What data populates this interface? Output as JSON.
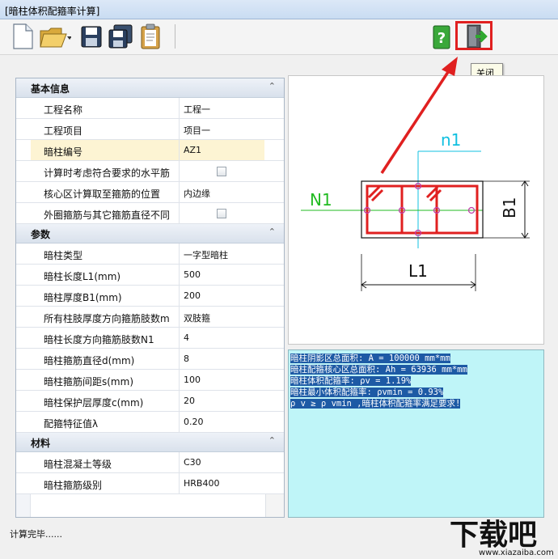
{
  "window": {
    "title": "[暗柱体积配箍率计算]"
  },
  "toolbar": {
    "tooltip": "关闭",
    "icons": [
      "new-file-icon",
      "open-folder-icon",
      "save-icon",
      "save-all-icon",
      "clipboard-icon",
      "help-icon",
      "exit-icon"
    ]
  },
  "props": {
    "basic": {
      "header": "基本信息",
      "rows": [
        {
          "label": "工程名称",
          "value": "工程一"
        },
        {
          "label": "工程项目",
          "value": "项目一"
        },
        {
          "label": "暗柱编号",
          "value": "AZ1"
        },
        {
          "label": "计算时考虑符合要求的水平筋",
          "value": ""
        },
        {
          "label": "核心区计算取至箍筋的位置",
          "value": "内边缘"
        },
        {
          "label": "外圈箍筋与其它箍筋直径不同",
          "value": ""
        }
      ]
    },
    "params": {
      "header": "参数",
      "rows": [
        {
          "label": "暗柱类型",
          "value": "一字型暗柱"
        },
        {
          "label": "暗柱长度L1(mm)",
          "value": "500"
        },
        {
          "label": "暗柱厚度B1(mm)",
          "value": "200"
        },
        {
          "label": "所有柱肢厚度方向箍筋肢数m",
          "value": "双肢箍"
        },
        {
          "label": "暗柱长度方向箍筋肢数N1",
          "value": "4"
        },
        {
          "label": "暗柱箍筋直径d(mm)",
          "value": "8"
        },
        {
          "label": "暗柱箍筋间距s(mm)",
          "value": "100"
        },
        {
          "label": "暗柱保护层厚度c(mm)",
          "value": "20"
        },
        {
          "label": "配箍特征值λ",
          "value": "0.20"
        }
      ]
    },
    "material": {
      "header": "材料",
      "rows": [
        {
          "label": "暗柱混凝土等级",
          "value": "C30"
        },
        {
          "label": "暗柱箍筋级别",
          "value": "HRB400"
        }
      ]
    }
  },
  "diagram": {
    "n1": "n1",
    "N1": "N1",
    "B1": "B1",
    "L1": "L1"
  },
  "results": {
    "lines": [
      "暗柱阴影区总面积: A = 100000 mm*mm",
      "暗柱配箍核心区总面积: Ah = 63936 mm*mm",
      "暗柱体积配箍率: ρv = 1.19%",
      "暗柱最小体积配箍率: ρvmin = 0.93%",
      "ρ v ≥ ρ vmin ,暗柱体积配箍率满足要求!"
    ]
  },
  "status": {
    "text": "计算完毕......"
  },
  "watermark": {
    "text": "下载吧",
    "url": "www.xiazaiba.com"
  },
  "colors": {
    "accent_red": "#e02020",
    "selection": "#fdf4d3",
    "results_bg": "#bff5f8",
    "results_hl": "#1d5aa5",
    "diagram_green": "#22bb22",
    "diagram_cyan": "#11c0e0"
  }
}
